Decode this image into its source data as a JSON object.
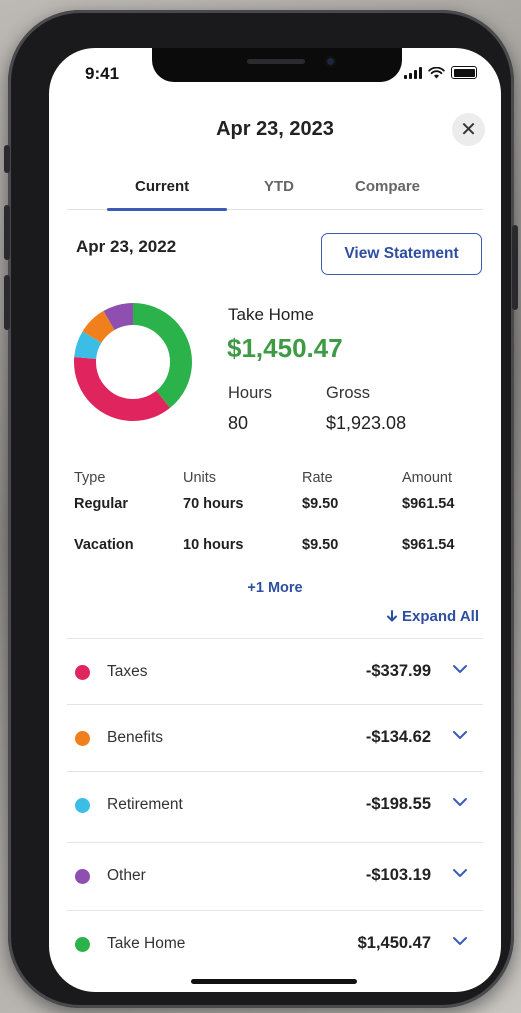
{
  "status_bar": {
    "time": "9:41"
  },
  "header": {
    "title": "Apr 23, 2023",
    "close_glyph": "✕"
  },
  "tabs": [
    {
      "label": "Current",
      "active": true
    },
    {
      "label": "YTD",
      "active": false
    },
    {
      "label": "Compare",
      "active": false
    }
  ],
  "statement": {
    "date": "Apr 23, 2022",
    "view_button": "View Statement",
    "take_home_label": "Take Home",
    "take_home_value": "$1,450.47",
    "hours_label": "Hours",
    "hours_value": "80",
    "gross_label": "Gross",
    "gross_value": "$1,923.08"
  },
  "earnings": {
    "headers": [
      "Type",
      "Units",
      "Rate",
      "Amount"
    ],
    "rows": [
      [
        "Regular",
        "70 hours",
        "$9.50",
        "$961.54"
      ],
      [
        "Vacation",
        "10 hours",
        "$9.50",
        "$961.54"
      ]
    ],
    "more_link": "+1 More"
  },
  "expand_all": "Expand All",
  "deductions": [
    {
      "name": "Taxes",
      "amount": "-$337.99",
      "color": "#e0245e"
    },
    {
      "name": "Benefits",
      "amount": "-$134.62",
      "color": "#f07f1d"
    },
    {
      "name": "Retirement",
      "amount": "-$198.55",
      "color": "#3bbde6"
    },
    {
      "name": "Other",
      "amount": "-$103.19",
      "color": "#8e4fb0"
    },
    {
      "name": "Take Home",
      "amount": "$1,450.47",
      "color": "#2cb24a"
    }
  ],
  "colors": {
    "accent": "#3b5bb5",
    "take_home_green": "#3e9a44"
  },
  "icons": {
    "close": "close-icon",
    "expand": "arrow-down-icon",
    "chevron": "chevron-down-icon"
  }
}
